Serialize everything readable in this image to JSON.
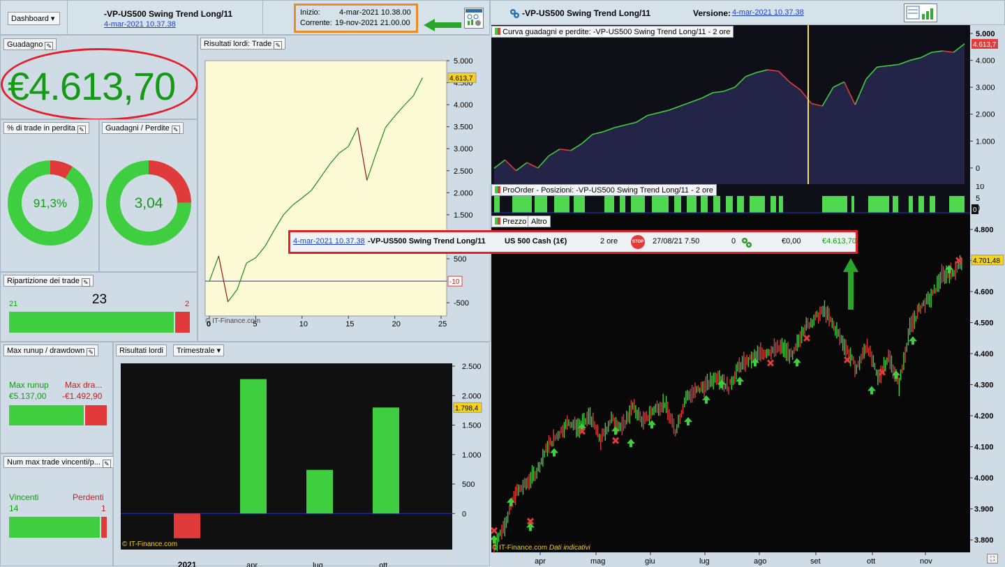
{
  "left_header": {
    "dashboard_btn": "Dashboard",
    "strategy": "-VP-US500 Swing Trend Long/11",
    "version_link": "4-mar-2021 10.37.38",
    "inizio_label": "Inizio:",
    "inizio_value": "4-mar-2021 10.38.00",
    "corrente_label": "Corrente:",
    "corrente_value": "19-nov-2021 21.00.00"
  },
  "right_header": {
    "strategy": "-VP-US500 Swing Trend Long/11",
    "versione_label": "Versione:",
    "versione_link": "4-mar-2021 10.37.38"
  },
  "guadagno": {
    "title": "Guadagno",
    "value": "€4.613,70"
  },
  "pct_loss": {
    "title": "% di trade in perdita",
    "value": "91,3%",
    "fraction": 0.913
  },
  "gain_loss": {
    "title": "Guadagni / Perdite",
    "value": "3,04",
    "fraction": 0.752
  },
  "ripartizione": {
    "title": "Ripartizione dei trade",
    "total": "23",
    "win": "21",
    "loss": "2"
  },
  "runup": {
    "title": "Max runup / drawdown",
    "runup_label": "Max runup",
    "runup_value": "€5.137,00",
    "dd_label": "Max dra...",
    "dd_value": "-€1.492,90"
  },
  "num_max": {
    "title": "Num max trade vincenti/p...",
    "win_label": "Vincenti",
    "loss_label": "Perdenti",
    "win": "14",
    "loss": "1"
  },
  "trade_chart": {
    "title": "Risultati lordi: Trade",
    "last": "4.613,7",
    "marker": "-10",
    "credit": "© IT-Finance.com"
  },
  "quarter_chart": {
    "title": "Risultati lordi",
    "select": "Trimestrale",
    "last": "1.798,4",
    "credit": "© IT-Finance.com"
  },
  "equity": {
    "title": "Curva guadagni e perdite: -VP-US500 Swing Trend Long/11 - 2 ore",
    "last": "4.613,7"
  },
  "positions": {
    "title": "ProOrder - Posizioni: -VP-US500 Swing Trend Long/11 - 2 ore",
    "last": "0"
  },
  "price": {
    "tab1": "Prezzo",
    "tab2": "Altro",
    "last": "4.701,48",
    "credit": "© IT-Finance.com",
    "credit2": "Dati indicativi"
  },
  "order_row": {
    "date": "4-mar-2021 10.37.38",
    "strategy": "-VP-US500 Swing Trend Long/11",
    "instrument": "US 500 Cash (1€)",
    "tf": "2 ore",
    "stop": "STOP",
    "time": "27/08/21 7.50",
    "qty": "0",
    "v1": "€0,00",
    "v2": "€4.613,70"
  },
  "chart_data": [
    {
      "type": "line",
      "title": "Risultati lordi: Trade",
      "x": [
        0,
        1,
        2,
        3,
        4,
        5,
        6,
        7,
        8,
        9,
        10,
        11,
        12,
        13,
        14,
        15,
        16,
        17,
        18,
        19,
        20,
        21,
        22,
        23
      ],
      "values": [
        -10,
        560,
        -480,
        -200,
        400,
        520,
        780,
        1150,
        1500,
        1720,
        1880,
        2050,
        2350,
        2650,
        2900,
        3050,
        3480,
        2280,
        2900,
        3480,
        3740,
        3980,
        4200,
        4613.7
      ],
      "xticks": [
        "0",
        "5",
        "10",
        "15",
        "20",
        "25"
      ],
      "yticks": [
        "-500",
        "500",
        "1.000",
        "1.500",
        "2.000",
        "2.500",
        "3.000",
        "3.500",
        "4.000",
        "4.500",
        "5.000"
      ],
      "ylim": [
        -800,
        5000
      ]
    },
    {
      "type": "bar",
      "title": "Risultati lordi",
      "categories": [
        "2021",
        "apr",
        "lug",
        "ott"
      ],
      "values": [
        -420,
        2280,
        740,
        1798.4
      ],
      "yticks": [
        "0",
        "500",
        "1.000",
        "1.500",
        "2.000",
        "2.500"
      ],
      "ylim": [
        -600,
        2500
      ]
    },
    {
      "type": "area",
      "title": "Curva guadagni e perdite",
      "yticks": [
        "0",
        "1.000",
        "2.000",
        "3.000",
        "4.000",
        "5.000"
      ],
      "ylim": [
        -600,
        5000
      ],
      "values": [
        -10,
        300,
        -100,
        200,
        0,
        450,
        700,
        650,
        900,
        1250,
        1350,
        1500,
        1600,
        1700,
        1950,
        2050,
        2150,
        2300,
        2450,
        2600,
        2800,
        2850,
        3000,
        3400,
        3550,
        3650,
        3600,
        3200,
        2900,
        2400,
        2300,
        3000,
        3200,
        2350,
        3300,
        3750,
        3800,
        3850,
        4000,
        4100,
        4300,
        4350,
        4300,
        4613.7
      ]
    },
    {
      "type": "line",
      "title": "Prezzo",
      "xticks": [
        "apr",
        "mag",
        "giu",
        "lug",
        "ago",
        "set",
        "ott",
        "nov"
      ],
      "yticks": [
        "3.800",
        "3.900",
        "4.000",
        "4.100",
        "4.200",
        "4.300",
        "4.400",
        "4.500",
        "4.600",
        "4.700",
        "4.800"
      ],
      "ylim": [
        3760,
        4820
      ],
      "values": [
        3780,
        3850,
        3950,
        3980,
        4020,
        4100,
        4140,
        4180,
        4160,
        4200,
        4120,
        4190,
        4160,
        4230,
        4180,
        4220,
        4240,
        4150,
        4260,
        4280,
        4300,
        4330,
        4290,
        4360,
        4380,
        4400,
        4410,
        4420,
        4390,
        4480,
        4510,
        4540,
        4480,
        4420,
        4350,
        4430,
        4320,
        4390,
        4300,
        4480,
        4550,
        4580,
        4650,
        4660,
        4701.48
      ]
    }
  ]
}
